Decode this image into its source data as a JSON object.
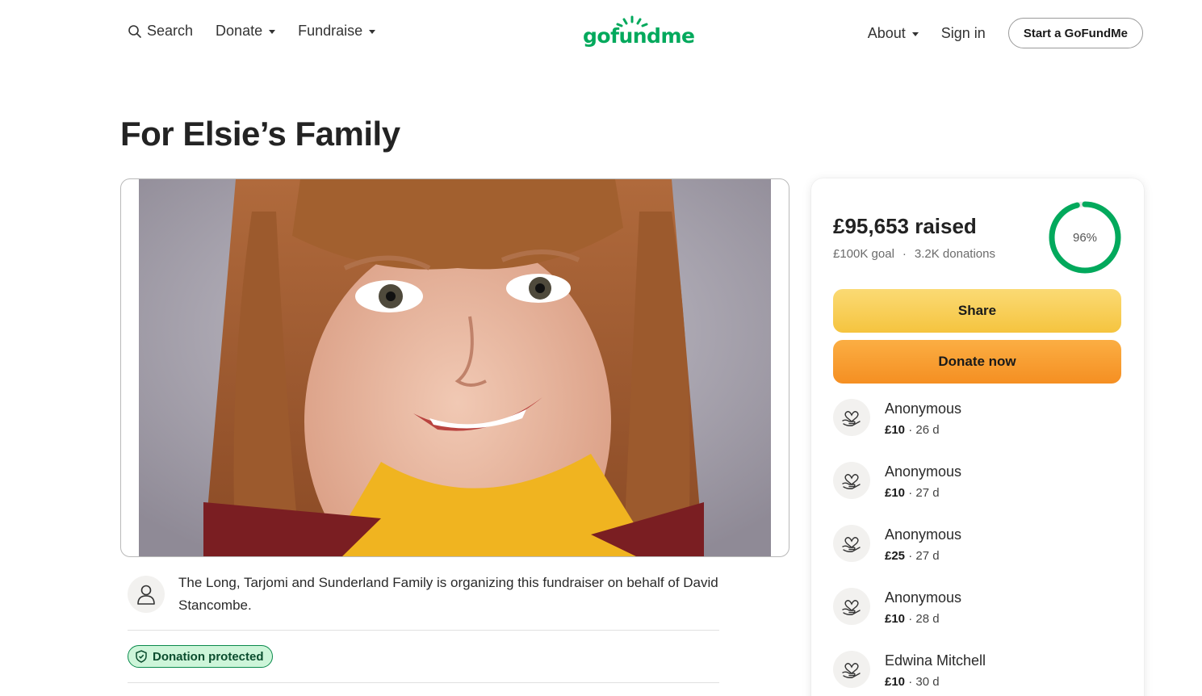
{
  "header": {
    "search_label": "Search",
    "donate_label": "Donate",
    "fundraise_label": "Fundraise",
    "logo_text": "gofundme",
    "about_label": "About",
    "signin_label": "Sign in",
    "start_label": "Start a GoFundMe"
  },
  "page": {
    "title": "For Elsie’s Family"
  },
  "organizer": {
    "text": "The Long, Tarjomi and Sunderland Family is organizing this fundraiser on behalf of David Stancombe."
  },
  "badge": {
    "label": "Donation protected"
  },
  "stats": {
    "raised": "£95,653 raised",
    "goal": "£100K goal",
    "separator": "·",
    "donations": "3.2K donations",
    "percent_label": "96%",
    "percent_value": 0.96
  },
  "actions": {
    "share_label": "Share",
    "donate_label": "Donate now"
  },
  "donors": [
    {
      "name": "Anonymous",
      "amount": "£10",
      "time": "· 26 d"
    },
    {
      "name": "Anonymous",
      "amount": "£10",
      "time": "· 27 d"
    },
    {
      "name": "Anonymous",
      "amount": "£25",
      "time": "· 27 d"
    },
    {
      "name": "Anonymous",
      "amount": "£10",
      "time": "· 28 d"
    },
    {
      "name": "Edwina Mitchell",
      "amount": "£10",
      "time": "· 30 d"
    }
  ],
  "colors": {
    "brand_green": "#02a95c",
    "share_yellow": "#f5c43f",
    "donate_orange": "#f58f22"
  }
}
